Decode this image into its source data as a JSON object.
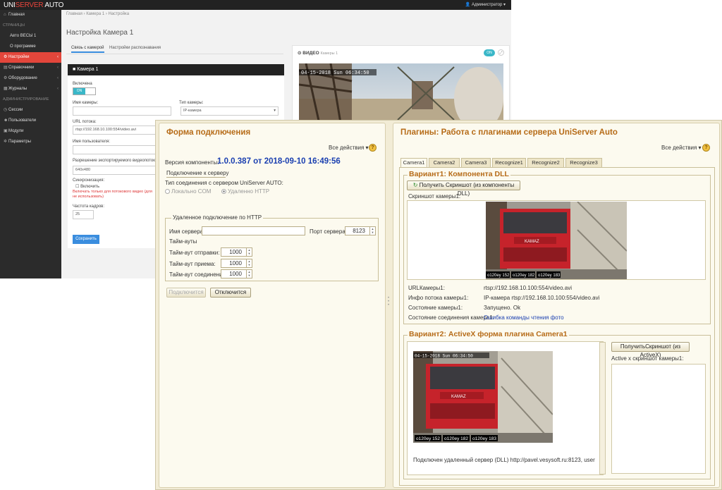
{
  "web": {
    "brand": {
      "part1": "UNI",
      "part2": "SERVER",
      "part3": " AUTO"
    },
    "user_menu": "Администратор",
    "sidebar": {
      "section_pages": "СТРАНИЦЫ",
      "item_home": "Главная",
      "item_auto_vesy": "Авто ВЕСЫ 1",
      "item_about": "О программе",
      "item_settings": "Настройки",
      "item_references": "Справочники",
      "item_equipment": "Оборудование",
      "item_journals": "Журналы",
      "section_admin": "АДМИНИСТРИРОВАНИЕ",
      "item_sessions": "Сессии",
      "item_users": "Пользователи",
      "item_modules": "Модули",
      "item_params": "Параметры"
    },
    "breadcrumb": {
      "home": "Главная",
      "camera": "Камера 1",
      "current": "Настройка",
      "sep": "›"
    },
    "page_title": "Настройка Камера 1",
    "tabs": {
      "connection": "Связь с камерой",
      "recognition": "Настройки распознавания"
    },
    "camera_panel": {
      "header": "Камера 1",
      "enabled_label": "Включена",
      "enabled_value": "ON",
      "camera_name_label": "Имя камеры:",
      "camera_type_label": "Тип камеры:",
      "camera_type_value": "IP-камера",
      "stream_url_label": "URL потока:",
      "stream_url_value": "rtsp://192.168.10.100:554/video.avi",
      "username_label": "Имя пользователя:",
      "resolution_label": "Разрешение экспортируемого видеопотока",
      "resolution_value": "640x480",
      "sync_label": "Синхронизация:",
      "sync_checkbox": "Включить",
      "sync_note1": "Включать только для потокового видео (для",
      "sync_note2": "не использовать)",
      "fps_label": "Частота кадров:",
      "fps_value": "25",
      "save_button": "Сохранить"
    },
    "video": {
      "title": "ВИДЕО",
      "subtitle": "Камеры 1",
      "toggle": "ON",
      "expand": "⤢",
      "timestamp": "04-15-2018 Sun 06:34:50"
    }
  },
  "app": {
    "left": {
      "title": "Форма подключения",
      "all_actions": "Все действия",
      "help": "?",
      "version_label": "Версия компоненты:",
      "version_value": "1.0.0.387 от 2018-09-10 16:49:56",
      "connect_section": "Подключение к серверу",
      "conn_type_label": "Тип соединения с сервером UniServer AUTO:",
      "radio_local": "Локально COM",
      "radio_remote": "Удаленно HTTP",
      "remote_group": "Удаленное подключение по HTTP",
      "server_name_label": "Имя сервера:",
      "server_port_label": "Порт сервера:",
      "server_port_value": "8123",
      "timeouts_label": "Тайм-ауты",
      "send_timeout_label": "Тайм-аут отправки:",
      "send_timeout_value": "1000",
      "recv_timeout_label": "Тайм-аут приема:",
      "recv_timeout_value": "1000",
      "conn_timeout_label": "Тайм-аут соединения:",
      "conn_timeout_value": "1000",
      "connect_button": "Подключится",
      "disconnect_button": "Отключится"
    },
    "right": {
      "title": "Плагины: Работа с плагинами сервера UniServer Auto",
      "all_actions": "Все действия",
      "help": "?",
      "tabs": [
        "Camera1",
        "Camera2",
        "Camera3",
        "Recognize1",
        "Recognize2",
        "Recognize3"
      ],
      "variant1": {
        "title": "Вариант1: Компонента DLL",
        "button": "Получить Скриншот (из компоненты DLL)",
        "screenshot_label": "Скриншот камеры1:",
        "plates": [
          "o120ey 152",
          "o120ey 182",
          "o120ey 183"
        ],
        "url_label": "URLКамеры1:",
        "url_value": "rtsp://192.168.10.100:554/video.avi",
        "stream_info_label": "Инфо потока камеры1:",
        "stream_info_value": "IP-камера rtsp://192.168.10.100:554/video.avi",
        "state_label": "Состояние камеры1:",
        "state_value": "Запущено. Ok",
        "conn_state_label": "Состояние соединения камера1:",
        "conn_state_value": "Ошибка команды чтения фото"
      },
      "variant2": {
        "title": "Вариант2: ActiveX форма плагина Camera1",
        "button": "ПолучитьСкриншот (из ActiveX)",
        "screenshot_label": "Active x скриншот камеры1:",
        "timestamp": "04-15-2018 Sun 06:34:50",
        "plates": [
          "o120ey 152",
          "o120ey 182",
          "o120ey 183"
        ],
        "status_text": "Подключен удаленный сервер (DLL) http://pavel.vesysoft.ru:8123, user"
      }
    }
  },
  "colors": {
    "accent_red": "#e3463b",
    "accent_blue": "#3a8dde",
    "title_orange": "#b66b17",
    "toggle_teal": "#3ab7c8"
  }
}
